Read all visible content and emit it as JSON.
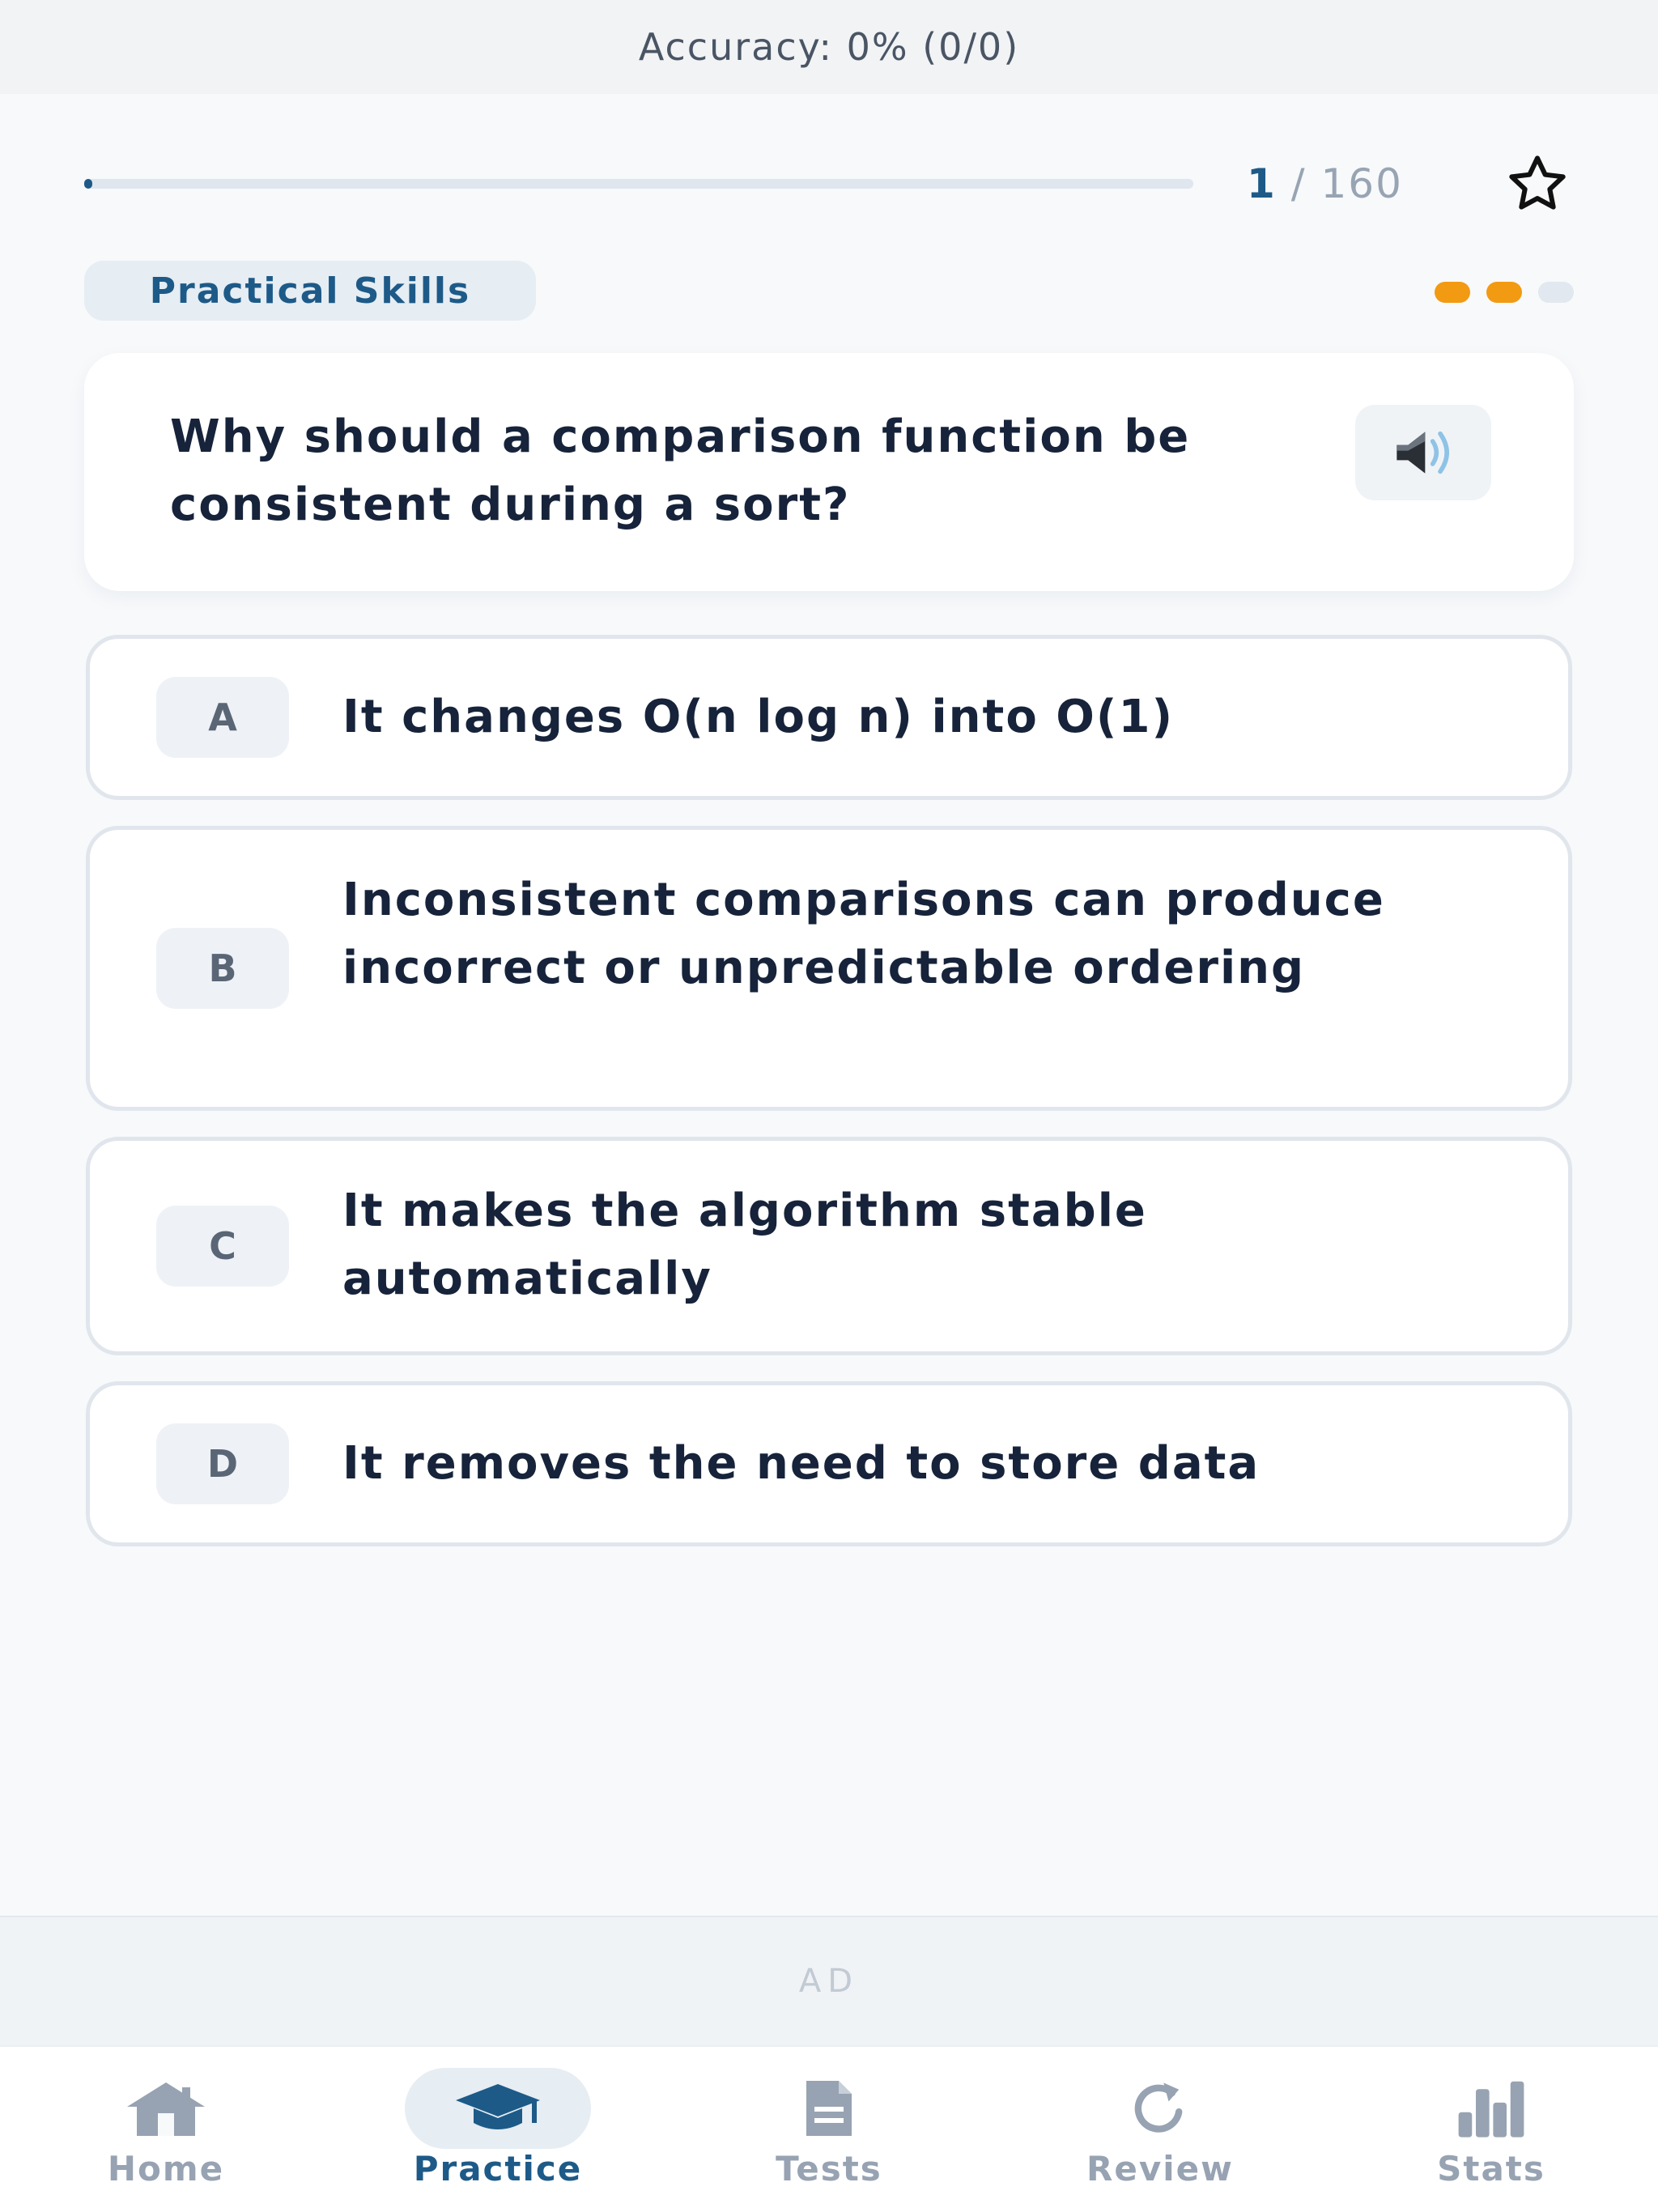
{
  "header": {
    "accuracy_text": "Accuracy: 0% (0/0)"
  },
  "progress": {
    "current": "1",
    "separator": "/",
    "total": "160",
    "fraction": 0.00625
  },
  "bookmark": {
    "icon": "star-outline-icon"
  },
  "category": {
    "label": "Practical Skills"
  },
  "difficulty": {
    "level": 2,
    "max": 3,
    "color_on": "#f29a12",
    "color_off": "#e2e8ef"
  },
  "question": {
    "text": "Why should a comparison function be consistent during a sort?",
    "audio_icon": "speaker-icon"
  },
  "options": [
    {
      "letter": "A",
      "text": "It changes O(n log n) into O(1)"
    },
    {
      "letter": "B",
      "text": "Inconsistent comparisons can produce incorrect or unpredictable ordering"
    },
    {
      "letter": "C",
      "text": "It makes the algorithm stable automatically"
    },
    {
      "letter": "D",
      "text": "It removes the need to store data"
    }
  ],
  "ad": {
    "label": "AD"
  },
  "nav": {
    "items": [
      {
        "label": "Home",
        "icon": "home-icon",
        "active": false
      },
      {
        "label": "Practice",
        "icon": "graduation-cap-icon",
        "active": true
      },
      {
        "label": "Tests",
        "icon": "document-icon",
        "active": false
      },
      {
        "label": "Review",
        "icon": "refresh-icon",
        "active": false
      },
      {
        "label": "Stats",
        "icon": "bar-chart-icon",
        "active": false
      }
    ]
  },
  "colors": {
    "accent": "#1d5a88",
    "muted": "#97a3b2",
    "warning": "#f29a12"
  }
}
